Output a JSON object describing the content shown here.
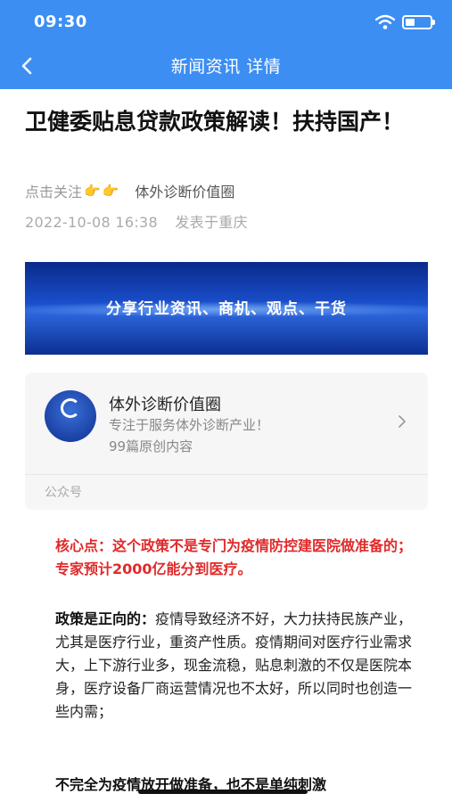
{
  "status_bar": {
    "time": "09:30"
  },
  "nav": {
    "title": "新闻资讯 详情"
  },
  "article": {
    "title": "卫健委贴息贷款政策解读！扶持国产！",
    "follow_text": "点击关注",
    "source_name": "体外诊断价值圈",
    "date": "2022-10-08 16:38",
    "location": "发表于重庆"
  },
  "banner": {
    "text": "分享行业资讯、商机、观点、干货"
  },
  "account_card": {
    "name": "体外诊断价值圈",
    "description": "专注于服务体外诊断产业！",
    "count": "99篇原创内容",
    "type": "公众号"
  },
  "content": {
    "core_point": "核心点：这个政策不是专门为疫情防控建医院做准备的；专家预计2000亿能分到医疗。",
    "para1_lead": "政策是正向的：",
    "para1_body": "疫情导致经济不好，大力扶持民族产业，尤其是医疗行业，重资产性质。疫情期间对医疗行业需求大，上下游行业多，现金流稳，贴息刺激的不仅是医院本身，医疗设备厂商运营情况也不太好，所以同时也创造一些内需；",
    "para2_lead": "不完全为疫情放开做准备，也不是单纯刺激"
  },
  "icons": {
    "back": "chevron-left-icon",
    "wifi": "wifi-icon",
    "battery": "battery-icon",
    "hand": "pointing-hand-icon",
    "chevron": "chevron-right-icon"
  },
  "colors": {
    "header": "#3c8ef3",
    "core_point": "#e02a2a",
    "card_bg": "#f6f6f7"
  }
}
